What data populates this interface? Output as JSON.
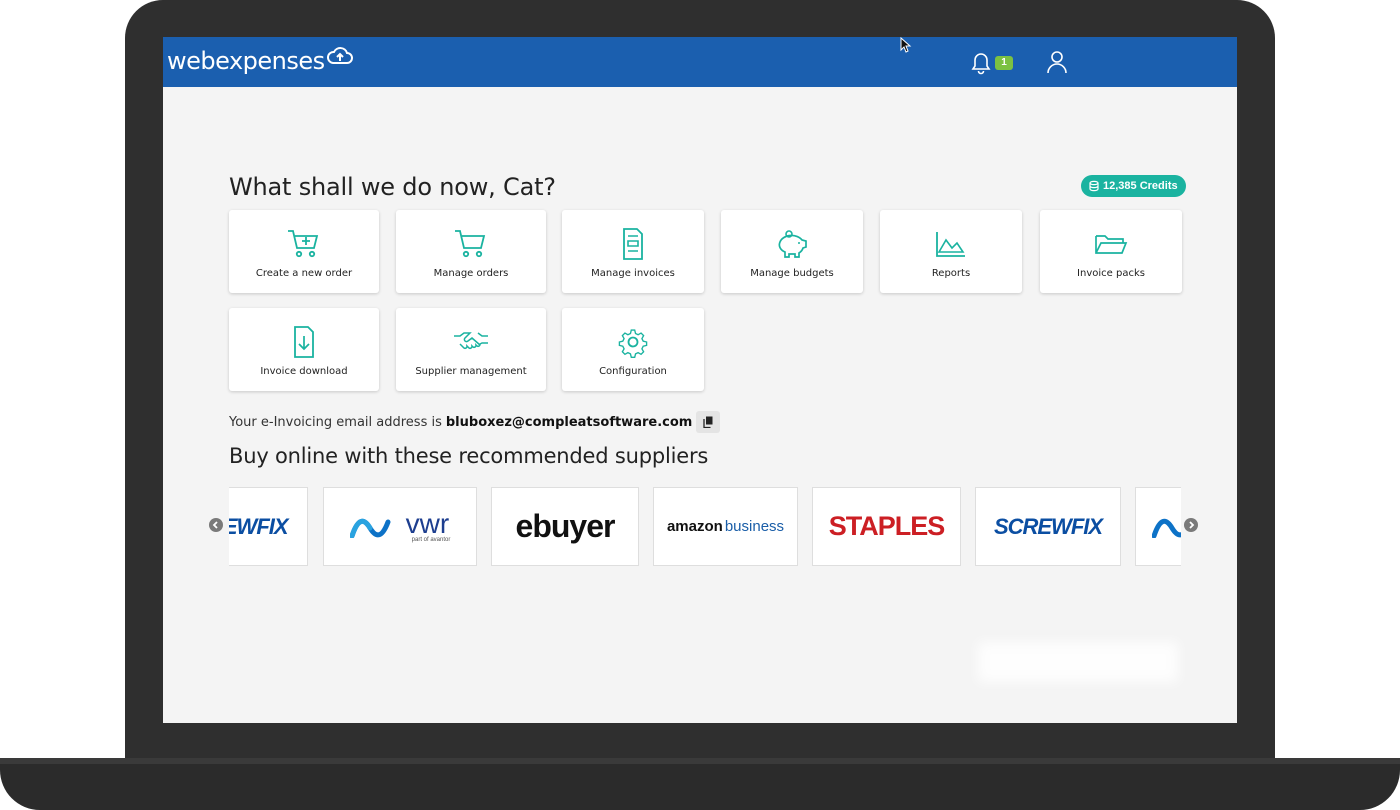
{
  "app": {
    "logo_text": "webexpenses",
    "notification_count": "1",
    "brand_color": "#1b5faf",
    "accent_color": "#1ab3a0"
  },
  "main": {
    "greeting": "What shall we do now, Cat?",
    "credits": "12,385 Credits",
    "tiles": [
      {
        "label": "Create a new order",
        "icon": "cart-plus-icon"
      },
      {
        "label": "Manage orders",
        "icon": "cart-icon"
      },
      {
        "label": "Manage invoices",
        "icon": "invoice-icon"
      },
      {
        "label": "Manage budgets",
        "icon": "piggy-bank-icon"
      },
      {
        "label": "Reports",
        "icon": "chart-icon"
      },
      {
        "label": "Invoice packs",
        "icon": "folder-icon"
      },
      {
        "label": "Invoice download",
        "icon": "file-download-icon"
      },
      {
        "label": "Supplier management",
        "icon": "handshake-icon"
      },
      {
        "label": "Configuration",
        "icon": "gear-icon"
      }
    ],
    "einvoice_prefix": "Your e-Invoicing email address is",
    "einvoice_address": "bluboxez@compleatsoftware.com",
    "suppliers_heading": "Buy online with these recommended suppliers",
    "suppliers": [
      {
        "name": "screwfix",
        "text": "SCREWFIX"
      },
      {
        "name": "vwr",
        "text": "vwr",
        "sub": "part of avantor"
      },
      {
        "name": "ebuyer",
        "text": "ebuyer"
      },
      {
        "name": "amazon-business",
        "text_a": "amazon",
        "text_b": "business"
      },
      {
        "name": "staples",
        "text": "STAPLES"
      },
      {
        "name": "screwfix",
        "text": "SCREWFIX"
      }
    ]
  }
}
